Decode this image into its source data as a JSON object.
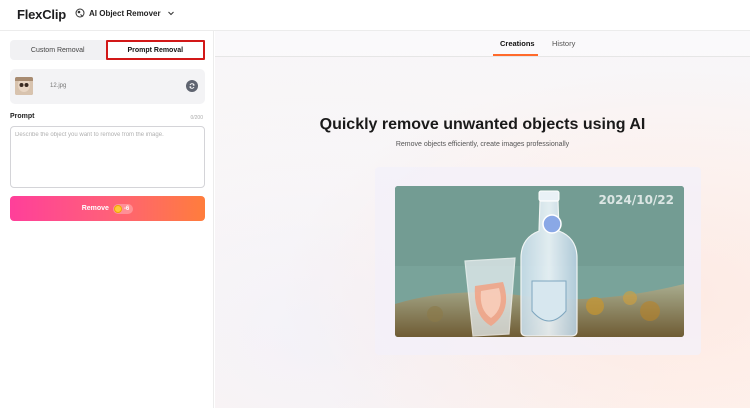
{
  "header": {
    "logo_text": "FlexClip",
    "tool_name": "AI Object Remover"
  },
  "left_panel": {
    "tabs": [
      {
        "label": "Custom Removal",
        "active": false
      },
      {
        "label": "Prompt Removal",
        "active": true
      }
    ],
    "file": {
      "name": "12.jpg"
    },
    "prompt": {
      "label": "Prompt",
      "count": "0/200",
      "placeholder": "Describe the object you want to remove from the image."
    },
    "remove_button": {
      "label": "Remove",
      "credits": "-6"
    }
  },
  "main": {
    "tabs": [
      {
        "label": "Creations",
        "active": true
      },
      {
        "label": "History",
        "active": false
      }
    ],
    "title": "Quickly remove unwanted objects using AI",
    "subtitle": "Remove objects efficiently, create images professionally",
    "preview": {
      "date_stamp": "2024/10/22"
    }
  },
  "colors": {
    "accent": "#ff6a2b",
    "highlight_border": "#d21818",
    "remove_gradient_start": "#ff3f9a",
    "remove_gradient_end": "#ff7d3c",
    "grammarly": "#15c39a"
  }
}
